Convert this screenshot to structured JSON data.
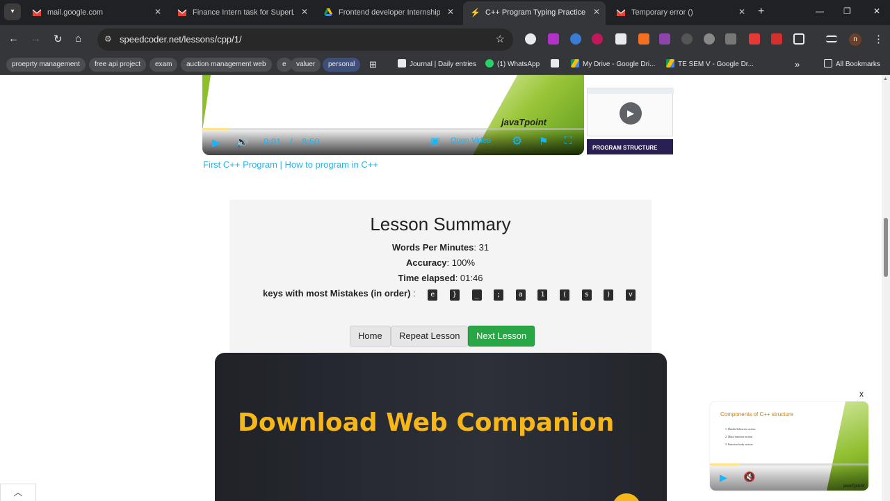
{
  "browser": {
    "tabs": [
      {
        "title": "mail.google.com",
        "favicon": "gmail-icon",
        "active": false
      },
      {
        "title": "Finance Intern task for SuperLabs",
        "favicon": "gmail-icon",
        "active": false
      },
      {
        "title": "Frontend developer Internship - S",
        "favicon": "google-drive-icon",
        "active": false
      },
      {
        "title": "C++ Program Typing Practice | Sp",
        "favicon": "speedcoder-icon",
        "active": true
      },
      {
        "title": "Temporary error ()",
        "favicon": "gmail-icon",
        "active": false
      }
    ],
    "new_tab": "+",
    "url": "speedcoder.net/lessons/cpp/1/",
    "profile_initial": "n",
    "bookmarks": [
      {
        "label": "proeprty management",
        "style": "pill"
      },
      {
        "label": "free api project",
        "style": "pill"
      },
      {
        "label": "exam",
        "style": "pill"
      },
      {
        "label": "auction management web",
        "style": "pill"
      },
      {
        "label": "e",
        "style": "pill"
      },
      {
        "label": "valuer",
        "style": "pill"
      },
      {
        "label": "personal",
        "style": "personal"
      },
      {
        "label": "Journal | Daily entries",
        "style": "plain"
      },
      {
        "label": "(1) WhatsApp",
        "style": "plain"
      },
      {
        "label": "My Drive - Google Dri...",
        "style": "plain"
      },
      {
        "label": "TE SEM V - Google Dr...",
        "style": "plain"
      }
    ],
    "more_bookmarks": "»",
    "all_bookmarks": "All Bookmarks"
  },
  "video": {
    "time_current": "0:01",
    "time_separator": "/",
    "time_total": "8:50",
    "progress": 0.07,
    "open_video_text": "Open Video",
    "watermark": "javaTpoint",
    "caption": "First C++ Program | How to program in C++",
    "related_thumbnail_text": "PROGRAM STRUCTURE"
  },
  "summary": {
    "title": "Lesson Summary",
    "wpm_label": "Words Per Minutes",
    "wpm_value": ": 31",
    "accuracy_label": "Accuracy",
    "accuracy_value": ": 100%",
    "time_label": "Time elapsed",
    "time_value": ": 01:46",
    "keys_label": "keys with most Mistakes (in order)",
    "keys_sep": " :",
    "keys": [
      "e",
      "}",
      "_",
      ";",
      "a",
      "1",
      "(",
      "s",
      ")",
      "v"
    ]
  },
  "actions": {
    "home": "Home",
    "repeat": "Repeat Lesson",
    "next": "Next Lesson"
  },
  "banner": {
    "headline": "Download Web Companion"
  },
  "mini_player": {
    "close": "x",
    "slide_title": "Components of C++ structure",
    "slide_items": [
      "Header/Libraries section",
      "Main function section",
      "Function body section"
    ],
    "progress": 0.19,
    "watermark": "javaTpoint"
  },
  "colors": {
    "accent_video": "#12b7ff",
    "next_button": "#28a745",
    "banner_headline": "#f7b718",
    "caption_link": "#2bb3e8"
  }
}
